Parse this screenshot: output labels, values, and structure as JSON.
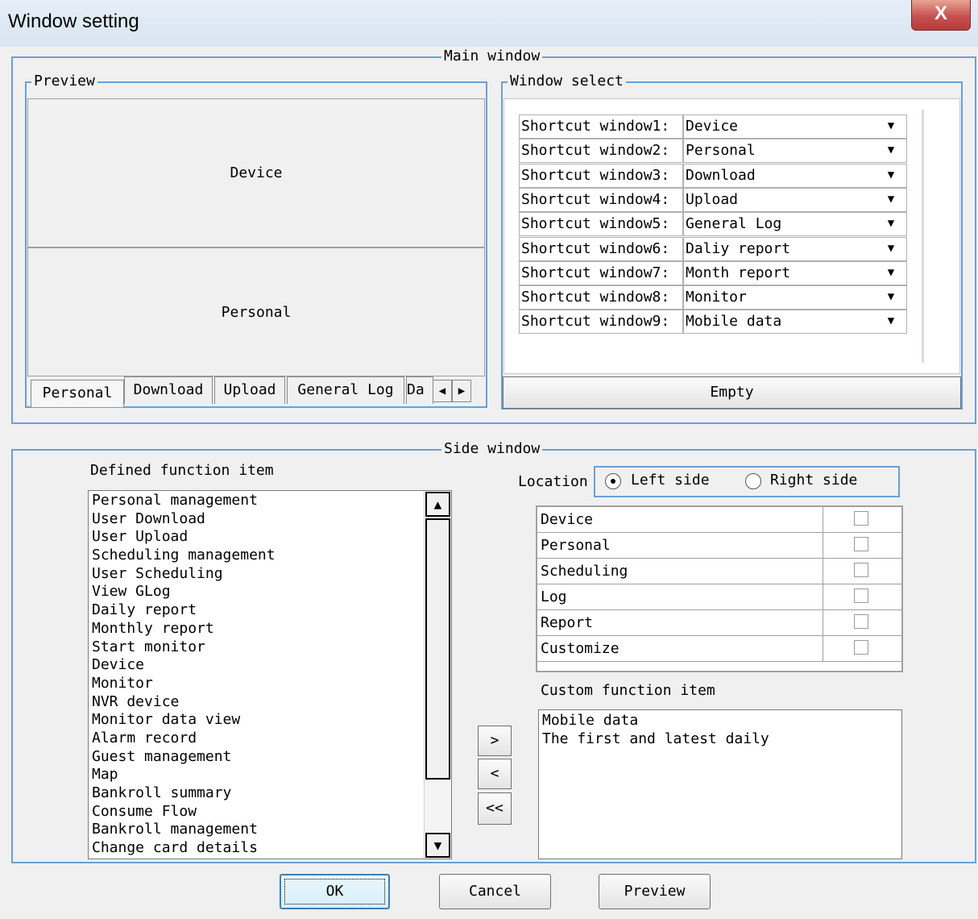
{
  "window": {
    "title": "Window setting",
    "close_label": "X"
  },
  "main_window": {
    "legend": "Main window",
    "preview": {
      "legend": "Preview",
      "panes": [
        "Device",
        "Personal"
      ],
      "tabs": [
        "Personal",
        "Download",
        "Upload",
        "General Log",
        "Da"
      ],
      "active_tab": "Personal"
    },
    "window_select": {
      "legend": "Window select",
      "rows": [
        {
          "label": "Shortcut window1:",
          "value": "Device"
        },
        {
          "label": "Shortcut window2:",
          "value": "Personal"
        },
        {
          "label": "Shortcut window3:",
          "value": "Download"
        },
        {
          "label": "Shortcut window4:",
          "value": "Upload"
        },
        {
          "label": "Shortcut window5:",
          "value": "General Log"
        },
        {
          "label": "Shortcut window6:",
          "value": "Daliy report"
        },
        {
          "label": "Shortcut window7:",
          "value": "Month report"
        },
        {
          "label": "Shortcut window8:",
          "value": "Monitor"
        },
        {
          "label": "Shortcut window9:",
          "value": "Mobile data"
        }
      ],
      "empty_button": "Empty"
    }
  },
  "side_window": {
    "legend": "Side window",
    "defined_label": "Defined function item",
    "defined_items": [
      "Personal management",
      "User Download",
      "User Upload",
      "Scheduling management",
      "User Scheduling",
      "View GLog",
      "Daily report",
      "Monthly report",
      "Start monitor",
      "Device",
      "Monitor",
      "NVR device",
      "Monitor data view",
      "Alarm record",
      "Guest management",
      "Map",
      "Bankroll summary",
      "Consume Flow",
      "Bankroll management",
      "Change card details"
    ],
    "location_label": "Location",
    "location_options": [
      "Left side",
      "Right side"
    ],
    "location_selected": "Left side",
    "categories": [
      "Device",
      "Personal",
      "Scheduling",
      "Log",
      "Report",
      "Customize"
    ],
    "move_buttons": {
      "add": ">",
      "remove": "<",
      "remove_all": "<<"
    },
    "custom_label": "Custom function item",
    "custom_items": [
      "Mobile data",
      "The first and latest daily"
    ]
  },
  "footer": {
    "ok": "OK",
    "cancel": "Cancel",
    "preview": "Preview"
  },
  "colors": {
    "group_border": "#6aa0d8",
    "close_button": "#c75050",
    "dialog_bg": "#f0f0f0"
  }
}
